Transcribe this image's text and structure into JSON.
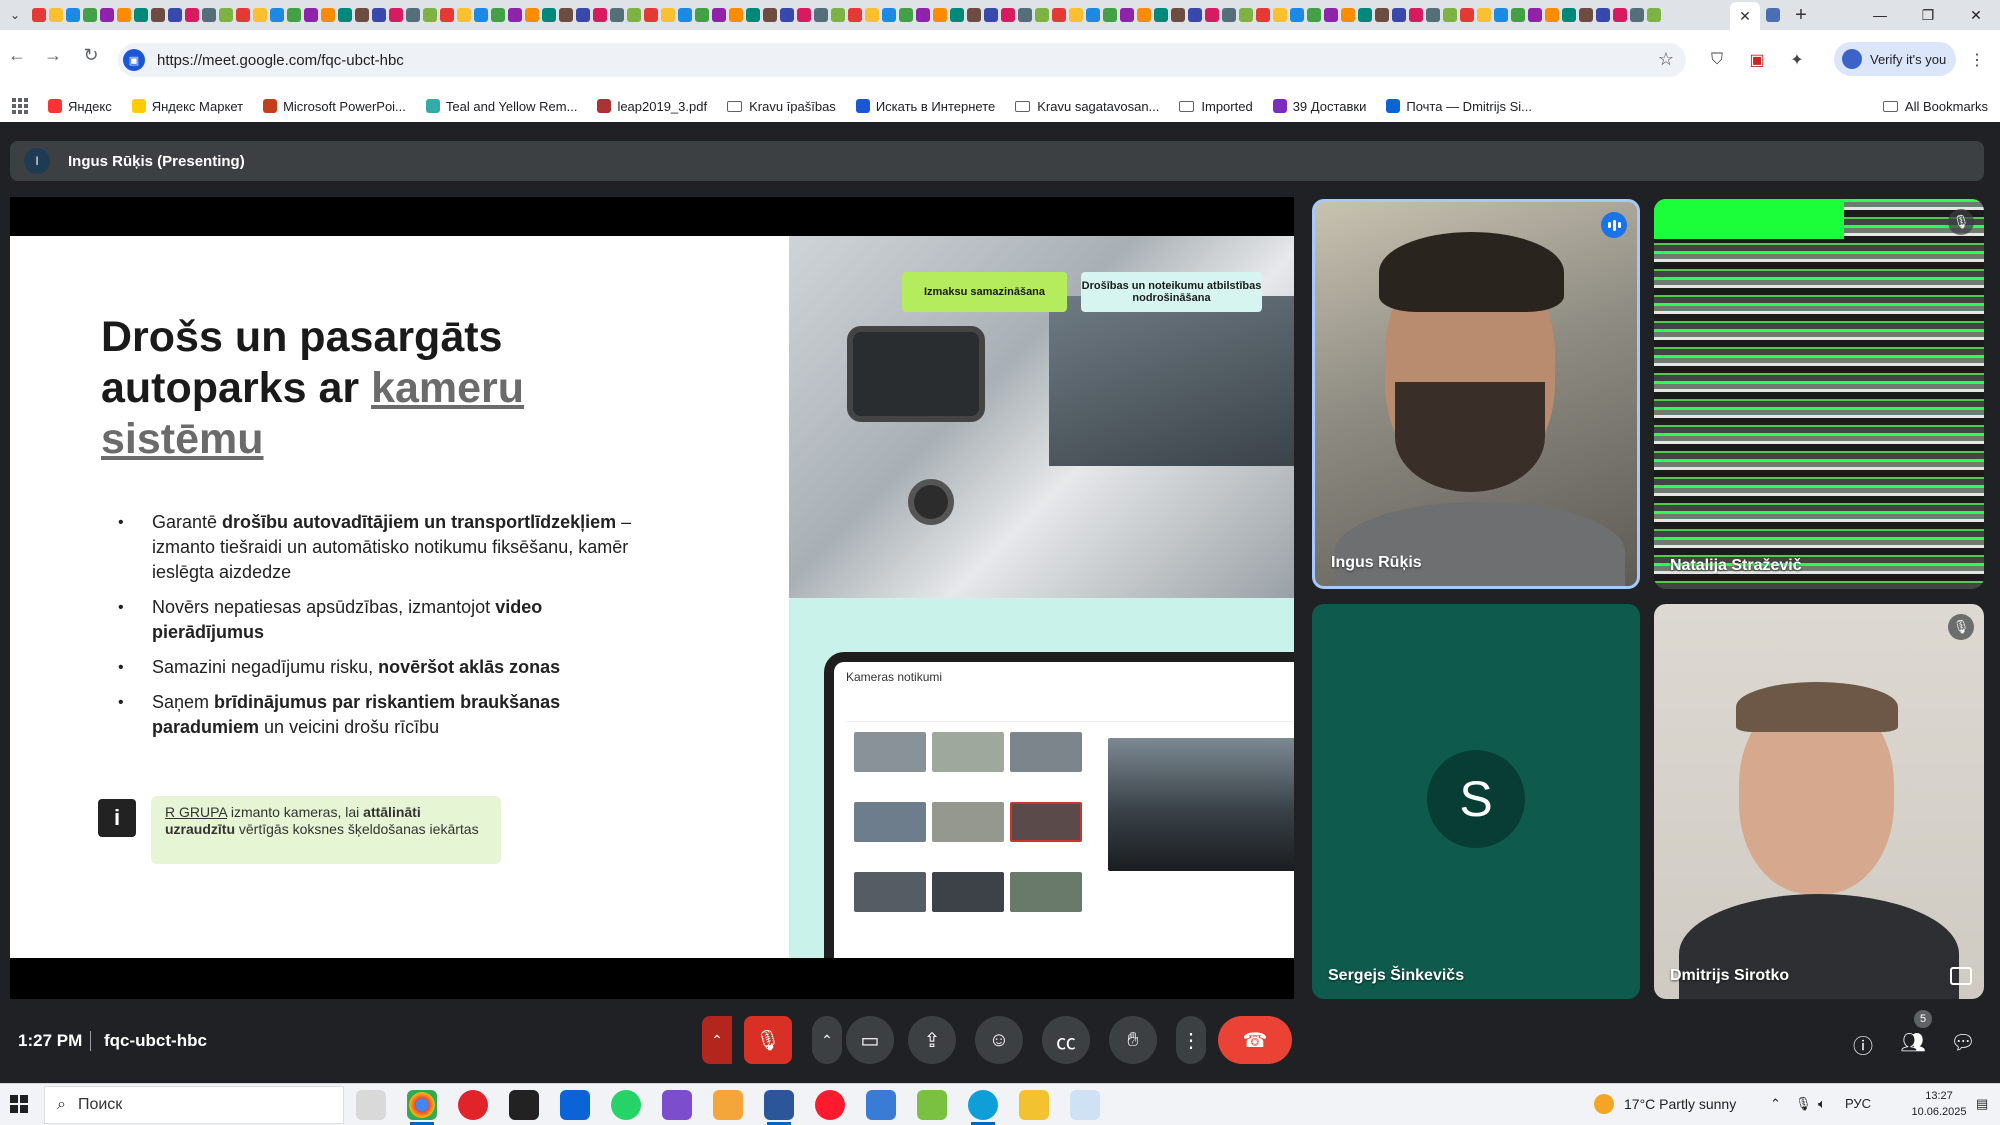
{
  "browser": {
    "url": "https://meet.google.com/fqc-ubct-hbc",
    "verify_label": "Verify it's you",
    "bookmarks": [
      {
        "label": "Яндекс",
        "color": "#f33"
      },
      {
        "label": "Яндекс Маркет",
        "color": "#fc0"
      },
      {
        "label": "Microsoft PowerPoi...",
        "color": "#c43e1c"
      },
      {
        "label": "Teal and Yellow Rem...",
        "color": "#3aa"
      },
      {
        "label": "leap2019_3.pdf",
        "color": "#a33"
      },
      {
        "label": "Kravu īpašības",
        "folder": true
      },
      {
        "label": "Искать в Интернете",
        "color": "#1a57d6"
      },
      {
        "label": "Kravu sagatavosan...",
        "folder": true
      },
      {
        "label": "Imported",
        "folder": true
      },
      {
        "label": "39 Доставки",
        "color": "#7b2cbf"
      },
      {
        "label": "Почта — Dmitrijs Si...",
        "color": "#0a64d6"
      }
    ],
    "all_bookmarks_label": "All Bookmarks"
  },
  "meet": {
    "presenter_initial": "I",
    "presenting_label": "Ingus Rūķis (Presenting)",
    "slide": {
      "title_part1": "Drošs un pasargāts autoparks ar",
      "title_highlight": "kameru sistēmu",
      "tag1": "Izmaksu samazināšana",
      "tag2": "Drošības un noteikumu atbilstības nodrošināšana",
      "bullets": [
        {
          "pre": "Garantē ",
          "bold": "drošību autovadītājiem un transportlīdzekļiem",
          "post": " – izmanto tiešraidi un automātisko notikumu fiksēšanu, kamēr ieslēgta aizdedze"
        },
        {
          "pre": "Novērs nepatiesas apsūdzības, izmantojot ",
          "bold": "video pierādījumus",
          "post": ""
        },
        {
          "pre": "Samazini negadījumu risku, ",
          "bold": "novēršot aklās zonas",
          "post": ""
        },
        {
          "pre": "Saņem ",
          "bold": "brīdinājumus par riskantiem braukšanas paradumiem",
          "post": " un veicini drošu rīcību"
        }
      ],
      "info_icon": "i",
      "info_link": "R GRUPA",
      "info_text1": " izmanto kameras, lai ",
      "info_bold": "attālināti uzraudzītu",
      "info_text2": " vērtīgās koksnes šķeldošanas iekārtas",
      "tablet_title": "Kameras notikumi"
    },
    "participants": [
      {
        "name": "Ingus Rūķis",
        "speaking": true
      },
      {
        "name": "Natalija Straževič",
        "muted": true
      },
      {
        "name": "Sergejs Šinkevičs",
        "initial": "S"
      },
      {
        "name": "Dmitrijs Sirotko",
        "muted": true
      }
    ],
    "time": "1:27 PM",
    "meeting_code": "fqc-ubct-hbc",
    "people_count": "5"
  },
  "taskbar": {
    "search_placeholder": "Поиск",
    "weather": "17°C  Partly sunny",
    "lang": "РУС",
    "clock_time": "13:27",
    "clock_date": "10.06.2025"
  },
  "colors": {
    "meet_bg": "#202124",
    "leave_red": "#ea4335",
    "mic_muted_red": "#d93025",
    "speaking_blue": "#a8c7fa",
    "tag_green": "#b5ec5e"
  }
}
